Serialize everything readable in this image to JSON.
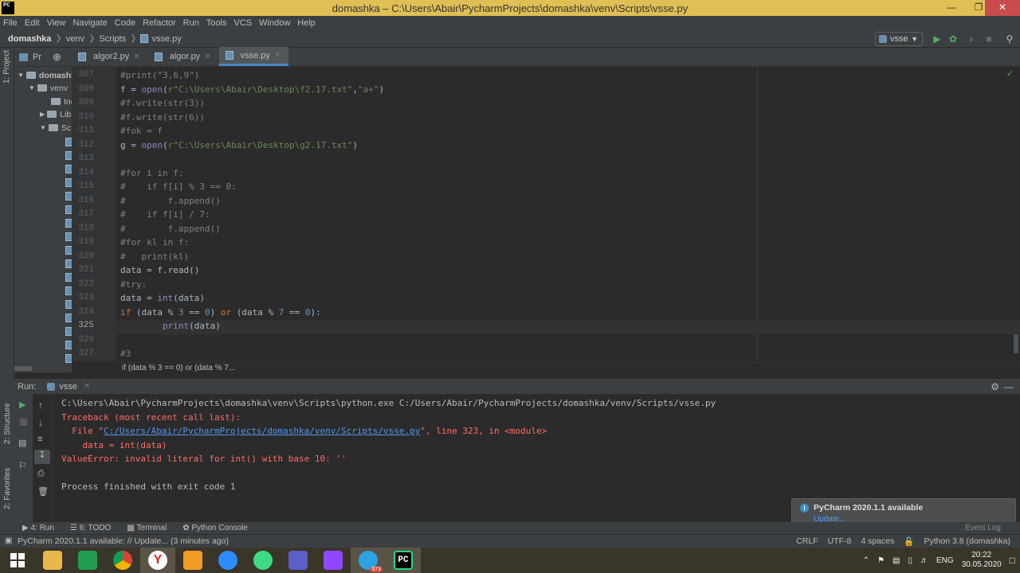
{
  "window": {
    "title": "domashka – C:\\Users\\Abair\\PycharmProjects\\domashka\\venv\\Scripts\\vsse.py"
  },
  "menu": [
    "File",
    "Edit",
    "View",
    "Navigate",
    "Code",
    "Refactor",
    "Run",
    "Tools",
    "VCS",
    "Window",
    "Help"
  ],
  "breadcrumb": {
    "project": "domashka",
    "venv": "venv",
    "scripts": "Scripts",
    "file": "vsse.py"
  },
  "run_config": "vsse",
  "left_tool": {
    "project_label": "1: Project",
    "structure_label": "2: Structure",
    "favorites_label": "2: Favorites"
  },
  "project_panel": {
    "title": "Pr",
    "root": "domashk",
    "venv": "venv",
    "inc": "Inc",
    "lib": "Lib",
    "scripts": "Sc"
  },
  "tabs": [
    {
      "label": "algor2.py"
    },
    {
      "label": "algor.py"
    },
    {
      "label": "vsse.py"
    }
  ],
  "line_numbers": [
    "307",
    "308",
    "309",
    "310",
    "311",
    "312",
    "313",
    "314",
    "315",
    "316",
    "317",
    "318",
    "319",
    "320",
    "321",
    "322",
    "323",
    "324",
    "325",
    "326",
    "327"
  ],
  "code_breadcrumb": "if (data % 3 == 0) or (data % 7...",
  "run_panel": {
    "label": "Run:",
    "tab": "vsse",
    "cmd": "C:\\Users\\Abair\\PycharmProjects\\domashka\\venv\\Scripts\\python.exe C:/Users/Abair/PycharmProjects/domashka/venv/Scripts/vsse.py",
    "traceback": "Traceback (most recent call last):",
    "file_prefix": "  File \"",
    "file_link": "C:/Users/Abair/PycharmProjects/domashka/venv/Scripts/vsse.py",
    "file_suffix": "\", line 323, in <module>",
    "code_line": "    data = int(data)",
    "error": "ValueError: invalid literal for int() with base 10: ''",
    "finish": "Process finished with exit code 1"
  },
  "bottom_tabs": [
    "4: Run",
    "6: TODO",
    "Terminal",
    "Python Console"
  ],
  "notification": {
    "title": "PyCharm 2020.1.1 available",
    "link": "Update..."
  },
  "event_log": "Event Log",
  "status": {
    "message": "PyCharm 2020.1.1 available: // Update... (3 minutes ago)",
    "line_sep": "CRLF",
    "encoding": "UTF-8",
    "indent": "4 spaces",
    "interpreter": "Python 3.8 (domashka)"
  },
  "taskbar": {
    "time": "20:22",
    "date": "30.05.2020",
    "lang": "ENG",
    "badge": "573"
  },
  "colors": {
    "titlebar": "#e0bf55",
    "accent": "#4a88c7",
    "error": "#ff6b68",
    "editor_bg": "#2b2b2b"
  }
}
